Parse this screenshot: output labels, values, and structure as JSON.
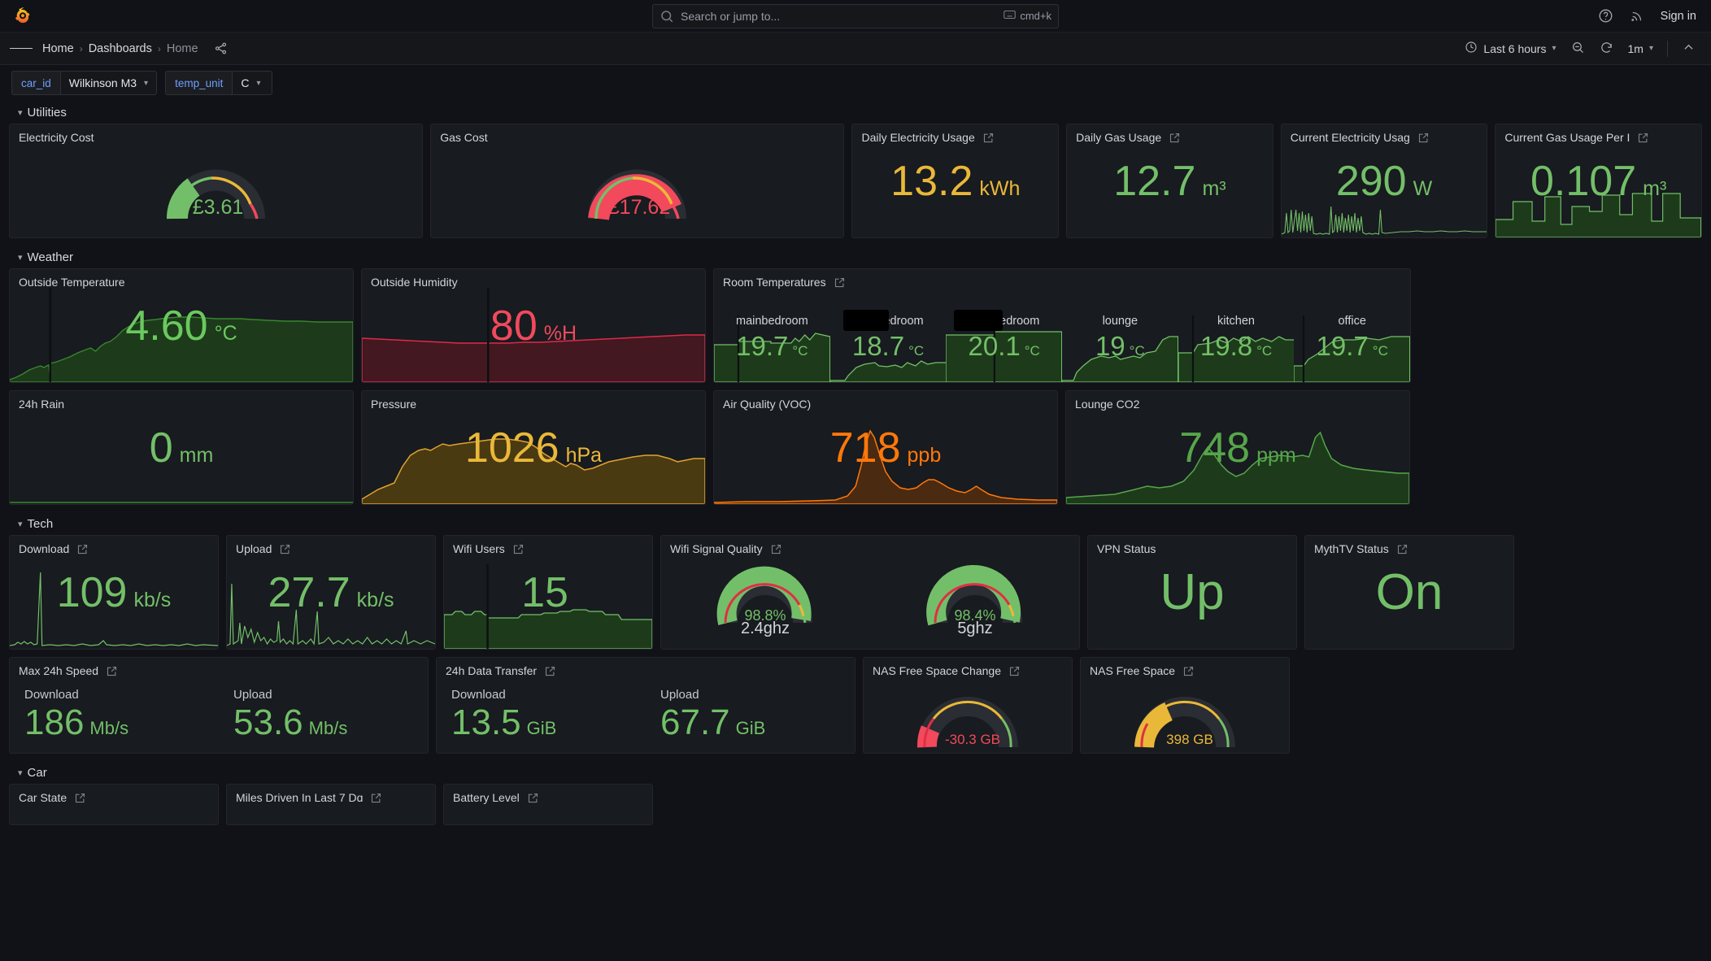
{
  "topnav": {
    "logo_icon": "grafana-logo-icon",
    "search": {
      "placeholder": "Search or jump to...",
      "icon": "search-icon",
      "shortcut": "cmd+k",
      "shortcut_icon": "keyboard-icon"
    },
    "help_icon": "help-circle-icon",
    "news_icon": "rss-icon",
    "signin_label": "Sign in"
  },
  "breadcrumb": {
    "menu_icon": "hamburger-menu-icon",
    "items": [
      "Home",
      "Dashboards",
      "Home"
    ],
    "separator": "›",
    "share_icon": "share-icon"
  },
  "timecontrols": {
    "time_range": "Last 6 hours",
    "time_icon": "clock-icon",
    "zoom_out_icon": "zoom-out-icon",
    "refresh_icon": "refresh-icon",
    "refresh_interval": "1m",
    "collapse_icon": "chevron-up-icon"
  },
  "variables": [
    {
      "label": "car_id",
      "value": "Wilkinson M3"
    },
    {
      "label": "temp_unit",
      "value": "C"
    }
  ],
  "rows": [
    {
      "title": "Utilities",
      "collapse_icon": "chevron-down-icon"
    },
    {
      "title": "Weather",
      "collapse_icon": "chevron-down-icon"
    },
    {
      "title": "Tech",
      "collapse_icon": "chevron-down-icon"
    },
    {
      "title": "Car",
      "collapse_icon": "chevron-down-icon"
    }
  ],
  "utilities": {
    "electricity_cost": {
      "title": "Electricity Cost",
      "value": "£3.61",
      "color": "#73bf69"
    },
    "gas_cost": {
      "title": "Gas Cost",
      "value": "£17.62",
      "color": "#f2495c"
    },
    "daily_electricity": {
      "title": "Daily Electricity Usage",
      "value": "13.2",
      "unit": "kWh",
      "color": "#eab839",
      "link_icon": "external-link-icon"
    },
    "daily_gas": {
      "title": "Daily Gas Usage",
      "value": "12.7",
      "unit": "m³",
      "color": "#73bf69",
      "link_icon": "external-link-icon"
    },
    "current_electricity": {
      "title": "Current Electricity Usag",
      "value": "290",
      "unit": "W",
      "color": "#73bf69",
      "link_icon": "external-link-icon"
    },
    "current_gas": {
      "title": "Current Gas Usage Per I",
      "value": "0.107",
      "unit": "m³",
      "color": "#73bf69",
      "link_icon": "external-link-icon"
    }
  },
  "weather": {
    "outside_temperature": {
      "title": "Outside Temperature",
      "value": "4.60",
      "unit": "°C",
      "color": "#37872d"
    },
    "outside_humidity": {
      "title": "Outside Humidity",
      "value": "80",
      "unit": "%H",
      "color": "#f2495c"
    },
    "room_temperatures": {
      "title": "Room Temperatures",
      "link_icon": "external-link-icon",
      "unit": "°C",
      "color": "#73bf69",
      "rooms": [
        {
          "name": "mainbedroom",
          "value": "19.7",
          "redacted": false
        },
        {
          "name": "bedroom",
          "value": "18.7",
          "redacted": true
        },
        {
          "name": "bedroom",
          "value": "20.1",
          "redacted": true
        },
        {
          "name": "lounge",
          "value": "19",
          "redacted": false
        },
        {
          "name": "kitchen",
          "value": "19.8",
          "redacted": false
        },
        {
          "name": "office",
          "value": "19.7",
          "redacted": false
        }
      ]
    },
    "rain_24h": {
      "title": "24h Rain",
      "value": "0",
      "unit": "mm",
      "color": "#73bf69"
    },
    "pressure": {
      "title": "Pressure",
      "value": "1026",
      "unit": "hPa",
      "color": "#eab839"
    },
    "air_quality": {
      "title": "Air Quality (VOC)",
      "value": "718",
      "unit": "ppb",
      "color": "#ff780a"
    },
    "lounge_co2": {
      "title": "Lounge CO2",
      "value": "748",
      "unit": "ppm",
      "color": "#56a64b"
    }
  },
  "tech": {
    "download": {
      "title": "Download",
      "value": "109",
      "unit": "kb/s",
      "color": "#73bf69",
      "link_icon": "external-link-icon"
    },
    "upload": {
      "title": "Upload",
      "value": "27.7",
      "unit": "kb/s",
      "color": "#73bf69",
      "link_icon": "external-link-icon"
    },
    "wifi_users": {
      "title": "Wifi Users",
      "value": "15",
      "unit": "",
      "color": "#73bf69",
      "link_icon": "external-link-icon"
    },
    "wifi_signal": {
      "title": "Wifi Signal Quality",
      "link_icon": "external-link-icon",
      "gauges": [
        {
          "label": "2.4ghz",
          "value": "98.8%",
          "pct": 98.8,
          "color": "#73bf69"
        },
        {
          "label": "5ghz",
          "value": "98.4%",
          "pct": 98.4,
          "color": "#73bf69"
        }
      ]
    },
    "vpn_status": {
      "title": "VPN Status",
      "value": "Up",
      "color": "#73bf69"
    },
    "mythtv_status": {
      "title": "MythTV Status",
      "value": "On",
      "color": "#73bf69",
      "link_icon": "external-link-icon"
    },
    "max_24h_speed": {
      "title": "Max 24h Speed",
      "link_icon": "external-link-icon",
      "items": [
        {
          "label": "Download",
          "value": "186",
          "unit": "Mb/s",
          "color": "#73bf69"
        },
        {
          "label": "Upload",
          "value": "53.6",
          "unit": "Mb/s",
          "color": "#73bf69"
        }
      ]
    },
    "data_transfer_24h": {
      "title": "24h Data Transfer",
      "link_icon": "external-link-icon",
      "items": [
        {
          "label": "Download",
          "value": "13.5",
          "unit": "GiB",
          "color": "#73bf69"
        },
        {
          "label": "Upload",
          "value": "67.7",
          "unit": "GiB",
          "color": "#73bf69"
        }
      ]
    },
    "nas_free_change": {
      "title": "NAS Free Space Change",
      "value": "-30.3 GB",
      "pct": 14,
      "color": "#f2495c",
      "link_icon": "external-link-icon"
    },
    "nas_free_space": {
      "title": "NAS Free Space",
      "value": "398 GB",
      "pct": 30,
      "color": "#eab839",
      "link_icon": "external-link-icon"
    }
  },
  "car": {
    "car_state": {
      "title": "Car State",
      "link_icon": "external-link-icon"
    },
    "miles_driven": {
      "title": "Miles Driven In Last 7 Dɑ",
      "link_icon": "external-link-icon"
    },
    "battery_level": {
      "title": "Battery Level",
      "link_icon": "external-link-icon"
    }
  }
}
